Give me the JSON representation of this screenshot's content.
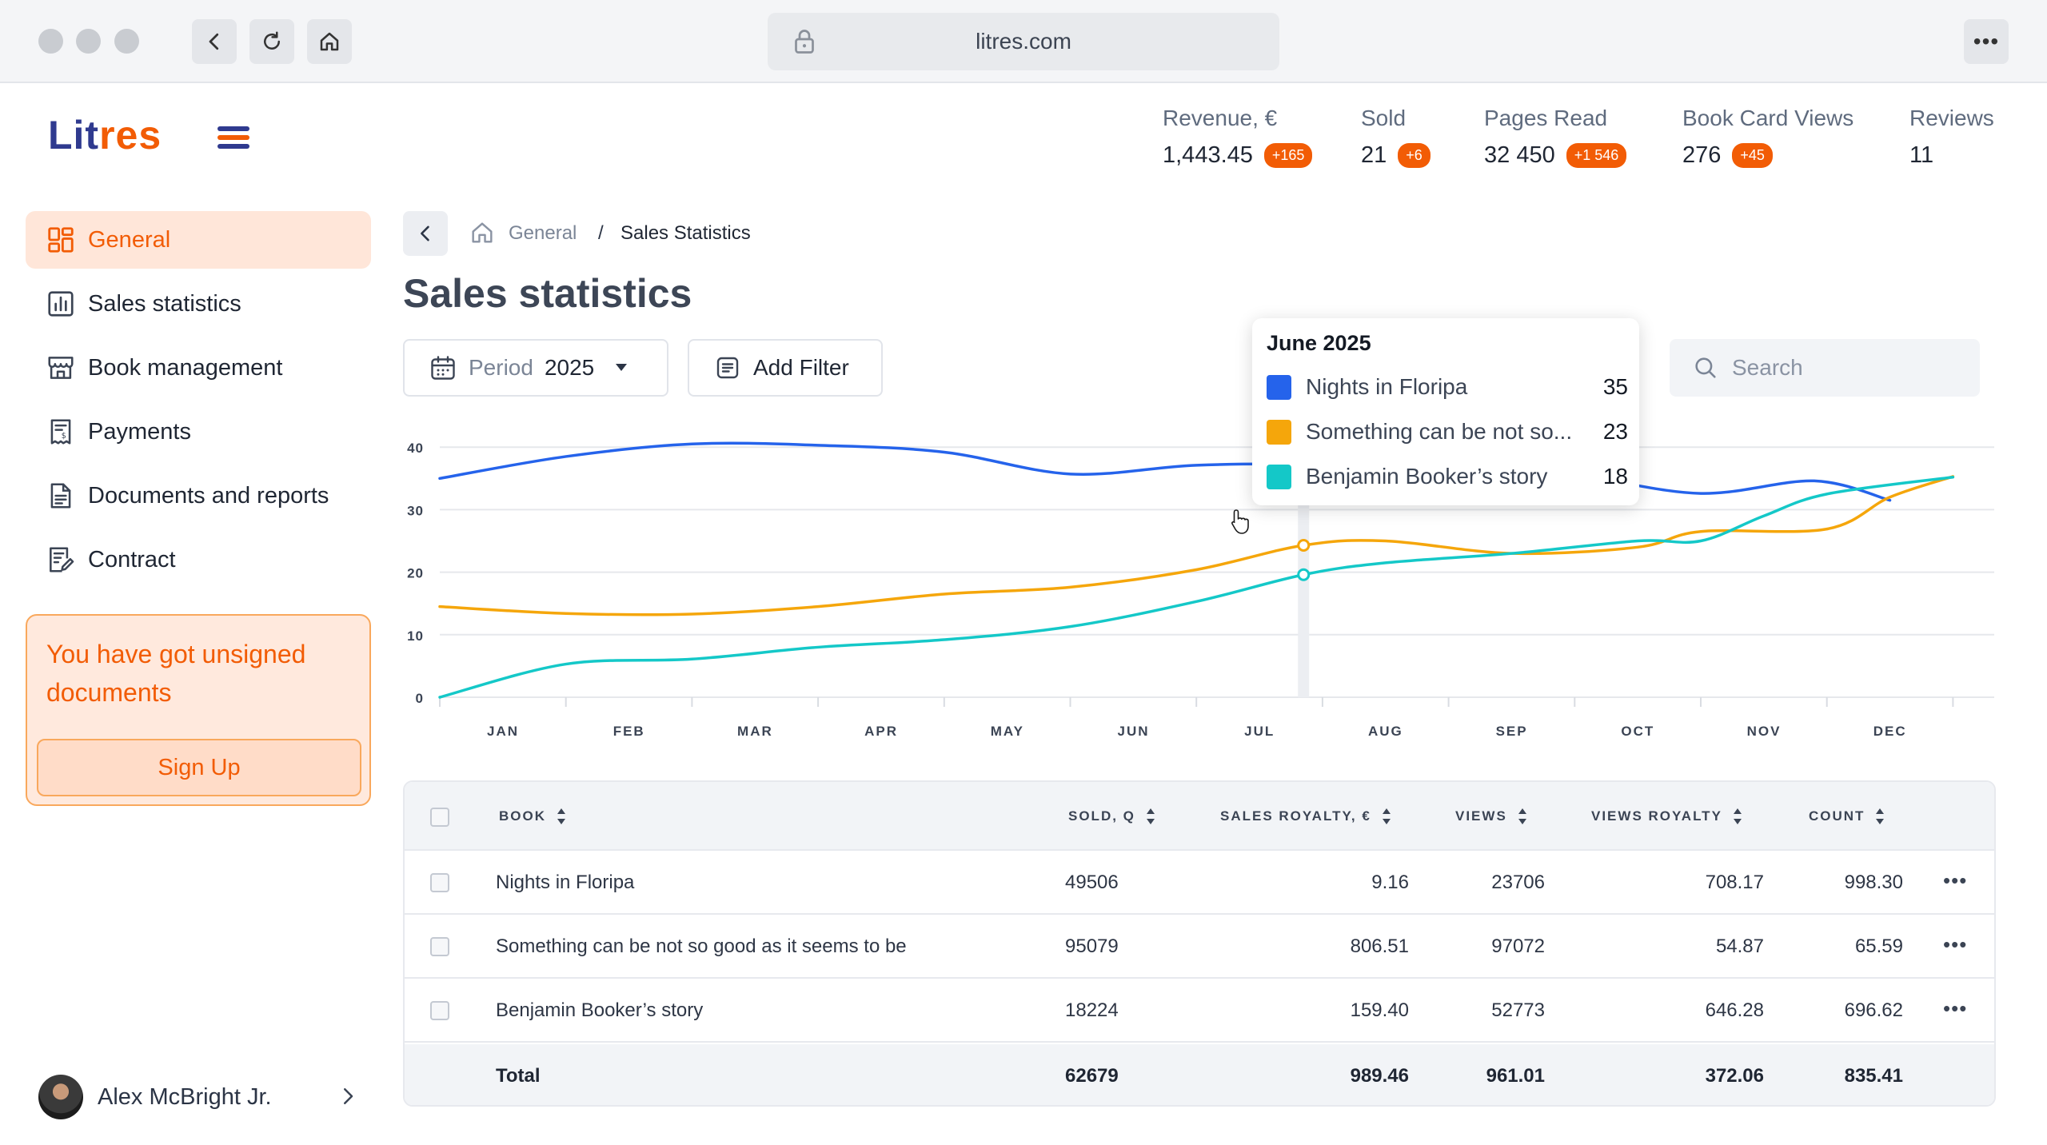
{
  "browser": {
    "url": "litres.com"
  },
  "logo": {
    "text_a": "Lit",
    "text_b": "res"
  },
  "stats": [
    {
      "label": "Revenue, €",
      "value": "1,443.45",
      "badge": "+165"
    },
    {
      "label": "Sold",
      "value": "21",
      "badge": "+6"
    },
    {
      "label": "Pages Read",
      "value": "32 450",
      "badge": "+1 546"
    },
    {
      "label": "Book Card Views",
      "value": "276",
      "badge": "+45"
    },
    {
      "label": "Reviews",
      "value": "11",
      "badge": ""
    }
  ],
  "sidebar": {
    "items": [
      {
        "label": "General",
        "icon": "dashboard-icon",
        "active": true
      },
      {
        "label": "Sales statistics",
        "icon": "bar-chart-icon"
      },
      {
        "label": "Book management",
        "icon": "store-icon"
      },
      {
        "label": "Payments",
        "icon": "receipt-icon"
      },
      {
        "label": "Documents and reports",
        "icon": "document-icon"
      },
      {
        "label": "Contract",
        "icon": "contract-icon"
      }
    ],
    "notice": {
      "message": "You have got unsigned documents",
      "button": "Sign Up"
    },
    "user": {
      "name": "Alex McBright Jr."
    }
  },
  "breadcrumb": {
    "home": "General",
    "separator": "/",
    "current": "Sales Statistics"
  },
  "page_title": "Sales statistics",
  "filters": {
    "period_label": "Period",
    "period_value": "2025",
    "add_filter": "Add Filter",
    "search_placeholder": "Search"
  },
  "colors": {
    "accent": "#f25c05",
    "series1": "#2563eb",
    "series2": "#f5a60b",
    "series3": "#14c8c8"
  },
  "chart_data": {
    "type": "line",
    "title": "",
    "xlabel": "",
    "ylabel": "",
    "categories": [
      "JAN",
      "FEB",
      "MAR",
      "APR",
      "MAY",
      "JUN",
      "JUL",
      "AUG",
      "SEP",
      "OCT",
      "NOV",
      "DEC"
    ],
    "yticks": [
      0,
      10,
      20,
      30,
      40
    ],
    "ylim": [
      0,
      40
    ],
    "grid": true,
    "series": [
      {
        "name": "Nights in Floripa",
        "color": "#2563eb",
        "values": [
          35,
          38.5,
          40.5,
          40.3,
          39.2,
          35.7,
          35.5,
          37.2,
          36.2,
          35.4,
          33.1,
          34.6,
          31.5
        ]
      },
      {
        "name": "Something can be not so good as it seems to be",
        "color": "#f5a60b",
        "values": [
          14.5,
          13.6,
          13.3,
          14.1,
          16.2,
          17.6,
          20.4,
          24.5,
          24.2,
          23,
          25.3,
          26.9,
          27.2,
          35.3
        ]
      },
      {
        "name": "Benjamin Booker’s story",
        "color": "#14c8c8",
        "values": [
          0,
          5.3,
          6.1,
          8,
          9.2,
          11.3,
          15.3,
          19.6,
          22.1,
          23.1,
          24.6,
          25.4,
          29.5,
          35.2
        ]
      }
    ],
    "series_points": [
      [
        [
          0,
          35
        ],
        [
          1,
          38.5
        ],
        [
          2,
          40.5
        ],
        [
          3,
          40.3
        ],
        [
          4,
          39.2
        ],
        [
          5,
          35.7
        ],
        [
          6,
          37.1
        ],
        [
          7,
          37.2
        ],
        [
          8,
          36.2
        ],
        [
          9,
          35.4
        ],
        [
          10,
          32.6
        ],
        [
          10.9,
          34.6
        ],
        [
          11.5,
          31.5
        ]
      ],
      [
        [
          0,
          14.5
        ],
        [
          1,
          13.4
        ],
        [
          2,
          13.3
        ],
        [
          3,
          14.5
        ],
        [
          4,
          16.5
        ],
        [
          5,
          17.6
        ],
        [
          6,
          20.4
        ],
        [
          6.85,
          24.3
        ],
        [
          7.5,
          25
        ],
        [
          8.5,
          23
        ],
        [
          9.5,
          24
        ],
        [
          10,
          26.5
        ],
        [
          11,
          26.9
        ],
        [
          11.5,
          32
        ],
        [
          12,
          35.3
        ]
      ],
      [
        [
          0,
          0
        ],
        [
          1,
          5.3
        ],
        [
          2,
          6.1
        ],
        [
          3,
          8
        ],
        [
          4,
          9.2
        ],
        [
          5,
          11.3
        ],
        [
          6,
          15.3
        ],
        [
          6.85,
          19.6
        ],
        [
          7.5,
          21.5
        ],
        [
          8.5,
          23
        ],
        [
          9.5,
          25
        ],
        [
          10,
          25
        ],
        [
          10.5,
          29
        ],
        [
          11,
          32.5
        ],
        [
          12,
          35.2
        ]
      ]
    ],
    "hover": {
      "x": 6.85,
      "points": [
        37.2,
        24.3,
        19.6
      ]
    },
    "tooltip": {
      "title": "June 2025",
      "items": [
        {
          "name": "Nights in Floripa",
          "display": "Nights in Floripa",
          "value": "35",
          "color": "#2563eb"
        },
        {
          "name": "Something can be not so good as it seems to be",
          "display": "Something can be not so...",
          "value": "23",
          "color": "#f5a60b"
        },
        {
          "name": "Benjamin Booker’s story",
          "display": "Benjamin Booker’s story",
          "value": "18",
          "color": "#14c8c8"
        }
      ]
    }
  },
  "table": {
    "columns": [
      "BOOK",
      "SOLD, Q",
      "SALES ROYALTY, €",
      "VIEWS",
      "VIEWS ROYALTY",
      "COUNT"
    ],
    "rows": [
      {
        "book": "Nights in Floripa",
        "sold": "49506",
        "sales_royalty": "9.16",
        "views": "23706",
        "views_royalty": "708.17",
        "count": "998.30"
      },
      {
        "book": "Something can be not so good as it seems to be",
        "sold": "95079",
        "sales_royalty": "806.51",
        "views": "97072",
        "views_royalty": "54.87",
        "count": "65.59"
      },
      {
        "book": "Benjamin Booker’s story",
        "sold": "18224",
        "sales_royalty": "159.40",
        "views": "52773",
        "views_royalty": "646.28",
        "count": "696.62"
      }
    ],
    "total": {
      "label": "Total",
      "sold": "62679",
      "sales_royalty": "989.46",
      "views": "961.01",
      "views_royalty": "372.06",
      "count": "835.41"
    }
  }
}
